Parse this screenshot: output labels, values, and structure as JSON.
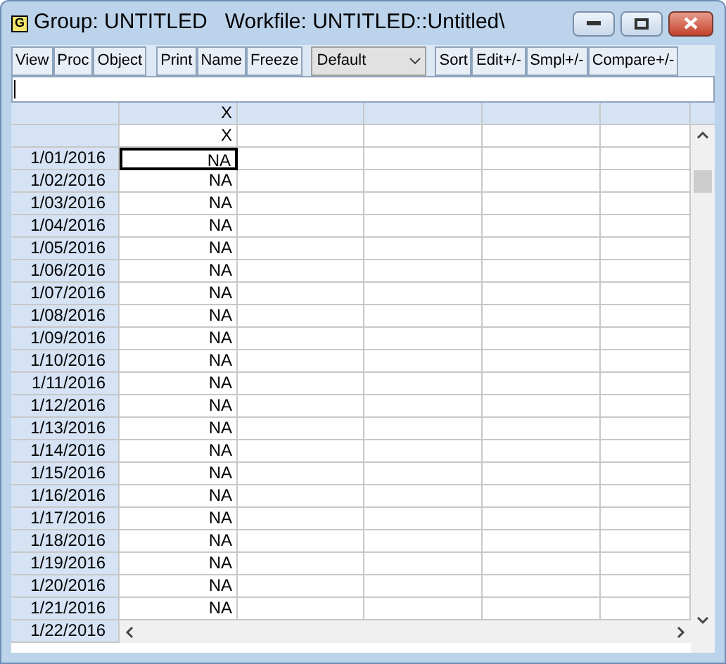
{
  "window": {
    "title": "Group: UNTITLED   Workfile: UNTITLED::Untitled\\",
    "icon_letter": "G"
  },
  "toolbar": [
    {
      "kind": "button",
      "label": "View"
    },
    {
      "kind": "button",
      "label": "Proc"
    },
    {
      "kind": "button",
      "label": "Object"
    },
    {
      "kind": "gap"
    },
    {
      "kind": "button",
      "label": "Print"
    },
    {
      "kind": "button",
      "label": "Name"
    },
    {
      "kind": "button",
      "label": "Freeze"
    },
    {
      "kind": "dropdown",
      "label": "Default"
    },
    {
      "kind": "button",
      "label": "Sort"
    },
    {
      "kind": "button",
      "label": "Edit+/-"
    },
    {
      "kind": "button",
      "label": "Smpl+/-"
    },
    {
      "kind": "button",
      "label": "Compare+/-"
    }
  ],
  "header_rows": [
    [
      "X"
    ],
    [
      "X"
    ]
  ],
  "rows": [
    {
      "date": "1/01/2016",
      "value": "NA",
      "selected": true
    },
    {
      "date": "1/02/2016",
      "value": "NA",
      "selected": false
    },
    {
      "date": "1/03/2016",
      "value": "NA",
      "selected": false
    },
    {
      "date": "1/04/2016",
      "value": "NA",
      "selected": false
    },
    {
      "date": "1/05/2016",
      "value": "NA",
      "selected": false
    },
    {
      "date": "1/06/2016",
      "value": "NA",
      "selected": false
    },
    {
      "date": "1/07/2016",
      "value": "NA",
      "selected": false
    },
    {
      "date": "1/08/2016",
      "value": "NA",
      "selected": false
    },
    {
      "date": "1/09/2016",
      "value": "NA",
      "selected": false
    },
    {
      "date": "1/10/2016",
      "value": "NA",
      "selected": false
    },
    {
      "date": "1/11/2016",
      "value": "NA",
      "selected": false
    },
    {
      "date": "1/12/2016",
      "value": "NA",
      "selected": false
    },
    {
      "date": "1/13/2016",
      "value": "NA",
      "selected": false
    },
    {
      "date": "1/14/2016",
      "value": "NA",
      "selected": false
    },
    {
      "date": "1/15/2016",
      "value": "NA",
      "selected": false
    },
    {
      "date": "1/16/2016",
      "value": "NA",
      "selected": false
    },
    {
      "date": "1/17/2016",
      "value": "NA",
      "selected": false
    },
    {
      "date": "1/18/2016",
      "value": "NA",
      "selected": false
    },
    {
      "date": "1/19/2016",
      "value": "NA",
      "selected": false
    },
    {
      "date": "1/20/2016",
      "value": "NA",
      "selected": false
    },
    {
      "date": "1/21/2016",
      "value": "NA",
      "selected": false
    }
  ],
  "last_row": {
    "date": "1/22/2016"
  }
}
